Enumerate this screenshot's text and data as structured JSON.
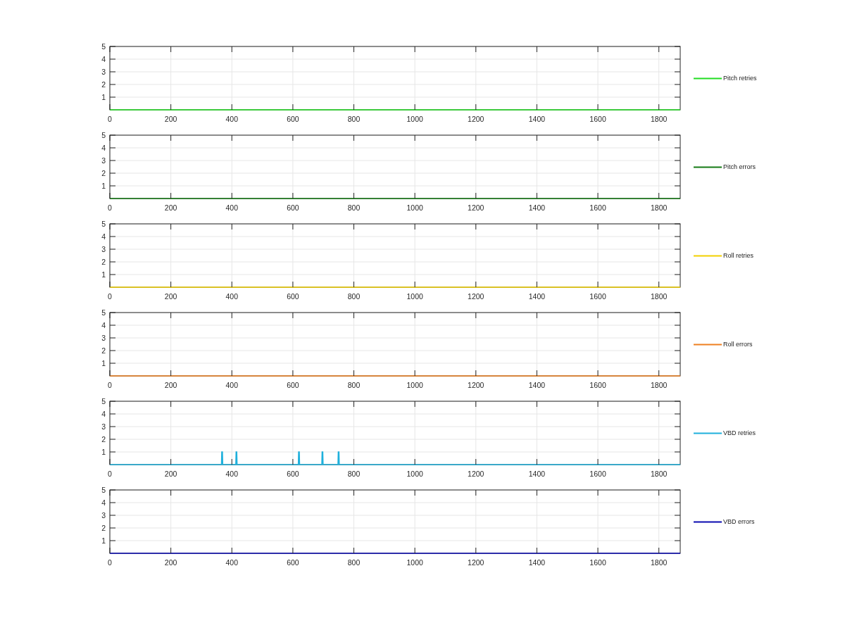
{
  "panels": [
    {
      "chart_data": {
        "type": "line",
        "grid": true,
        "xlim": [
          0,
          1870
        ],
        "ylim": [
          0,
          5
        ],
        "xticks": [
          0,
          200,
          400,
          600,
          800,
          1000,
          1200,
          1400,
          1600,
          1800
        ],
        "yticks": [
          1,
          2,
          3,
          4,
          5
        ],
        "x": [
          0,
          1870
        ],
        "series": [
          {
            "name": "Pitch retries",
            "color": "#22dd22",
            "values": [
              0,
              0
            ]
          }
        ]
      }
    },
    {
      "chart_data": {
        "type": "line",
        "grid": true,
        "xlim": [
          0,
          1870
        ],
        "ylim": [
          0,
          5
        ],
        "xticks": [
          0,
          200,
          400,
          600,
          800,
          1000,
          1200,
          1400,
          1600,
          1800
        ],
        "yticks": [
          1,
          2,
          3,
          4,
          5
        ],
        "x": [
          0,
          1870
        ],
        "series": [
          {
            "name": "Pitch errors",
            "color": "#157a15",
            "values": [
              0,
              0
            ]
          }
        ]
      }
    },
    {
      "chart_data": {
        "type": "line",
        "grid": true,
        "xlim": [
          0,
          1870
        ],
        "ylim": [
          0,
          5
        ],
        "xticks": [
          0,
          200,
          400,
          600,
          800,
          1000,
          1200,
          1400,
          1600,
          1800
        ],
        "yticks": [
          1,
          2,
          3,
          4,
          5
        ],
        "x": [
          0,
          1870
        ],
        "series": [
          {
            "name": "Roll retries",
            "color": "#f2d000",
            "values": [
              0,
              0
            ]
          }
        ]
      }
    },
    {
      "chart_data": {
        "type": "line",
        "grid": true,
        "xlim": [
          0,
          1870
        ],
        "ylim": [
          0,
          5
        ],
        "xticks": [
          0,
          200,
          400,
          600,
          800,
          1000,
          1200,
          1400,
          1600,
          1800
        ],
        "yticks": [
          1,
          2,
          3,
          4,
          5
        ],
        "x": [
          0,
          1870
        ],
        "series": [
          {
            "name": "Roll errors",
            "color": "#ee8020",
            "values": [
              0,
              0
            ]
          }
        ]
      }
    },
    {
      "chart_data": {
        "type": "line",
        "grid": true,
        "xlim": [
          0,
          1870
        ],
        "ylim": [
          0,
          5
        ],
        "xticks": [
          0,
          200,
          400,
          600,
          800,
          1000,
          1200,
          1400,
          1600,
          1800
        ],
        "yticks": [
          1,
          2,
          3,
          4,
          5
        ],
        "x": [
          0,
          366,
          367,
          369,
          370,
          413,
          414,
          416,
          417,
          618,
          619,
          621,
          622,
          695,
          696,
          698,
          699,
          748,
          749,
          751,
          752,
          1870
        ],
        "series": [
          {
            "name": "VBD retries",
            "color": "#1eb0dc",
            "values": [
              0,
              0,
              1,
              1,
              0,
              0,
              1,
              1,
              0,
              0,
              1,
              1,
              0,
              0,
              1,
              1,
              0,
              0,
              1,
              1,
              0,
              0
            ]
          }
        ]
      }
    },
    {
      "chart_data": {
        "type": "line",
        "grid": true,
        "xlim": [
          0,
          1870
        ],
        "ylim": [
          0,
          5
        ],
        "xticks": [
          0,
          200,
          400,
          600,
          800,
          1000,
          1200,
          1400,
          1600,
          1800
        ],
        "yticks": [
          1,
          2,
          3,
          4,
          5
        ],
        "x": [
          0,
          1870
        ],
        "series": [
          {
            "name": "VBD errors",
            "color": "#0a0ab0",
            "values": [
              0,
              0
            ]
          }
        ]
      }
    }
  ]
}
